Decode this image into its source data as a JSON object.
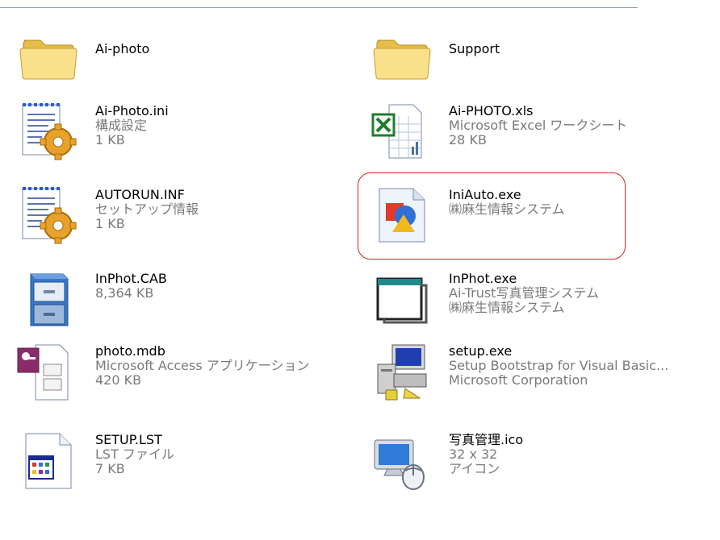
{
  "files": [
    {
      "name": "Ai-photo"
    },
    {
      "name": "Support"
    },
    {
      "name": "Ai-Photo.ini",
      "line2": "構成設定",
      "line3": "1 KB"
    },
    {
      "name": "Ai-PHOTO.xls",
      "line2": "Microsoft Excel ワークシート",
      "line3": "28 KB"
    },
    {
      "name": "AUTORUN.INF",
      "line2": "セットアップ情報",
      "line3": "1 KB"
    },
    {
      "name": "IniAuto.exe",
      "line2": "㈱麻生情報システム"
    },
    {
      "name": "InPhot.CAB",
      "line2": "8,364 KB"
    },
    {
      "name": "InPhot.exe",
      "line2": "Ai-Trust写真管理システム",
      "line3": "㈱麻生情報システム"
    },
    {
      "name": "photo.mdb",
      "line2": "Microsoft Access アプリケーション",
      "line3": "420 KB"
    },
    {
      "name": "setup.exe",
      "line2": "Setup Bootstrap for Visual Basic...",
      "line3": "Microsoft Corporation"
    },
    {
      "name": "SETUP.LST",
      "line2": "LST ファイル",
      "line3": "7 KB"
    },
    {
      "name": "写真管理.ico",
      "line2": "32 x 32",
      "line3": "アイコン"
    }
  ],
  "icons": [
    "folder-icon",
    "folder-icon",
    "config-settings-icon",
    "excel-spreadsheet-icon",
    "setup-information-icon",
    "application-exe-icon",
    "cabinet-archive-icon",
    "window-exe-icon",
    "access-database-icon",
    "setup-computer-icon",
    "lst-list-file-icon",
    "computer-mouse-icon"
  ],
  "colors": {
    "selection_outline": "#d42020",
    "meta_text": "#7a7a7a",
    "folder": "#f5d66b"
  }
}
